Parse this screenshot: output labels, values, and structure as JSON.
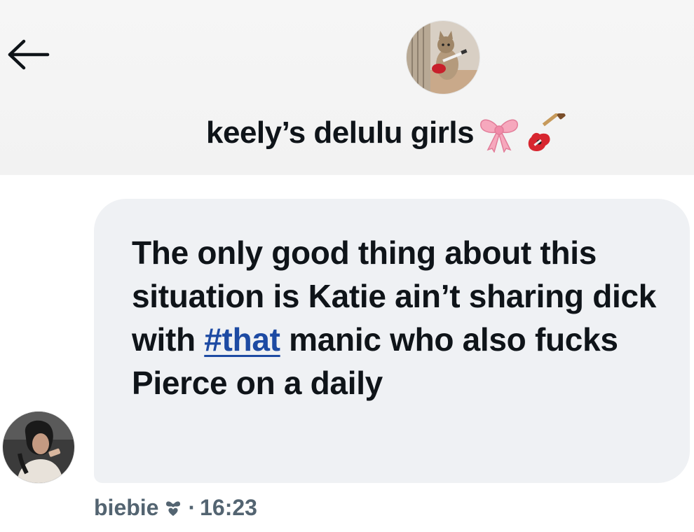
{
  "header": {
    "back_icon": "arrow-left-icon",
    "group_avatar_icon": "cat-with-guitar-avatar",
    "group_name": "keely’s delulu girls",
    "title_emojis": [
      "ribbon-emoji",
      "guitar-emoji"
    ]
  },
  "message": {
    "text_before_hashtag": "The only good thing about this situation is Katie ain’t sharing dick with",
    "hashtag": "#that",
    "text_after_hashtag": "manic who also fucks Pierce on a daily",
    "bubble_color": "#eff1f4",
    "hashtag_color": "#1d4aa3"
  },
  "sender": {
    "avatar_icon": "user-photo-avatar",
    "name": "biebie",
    "name_icon": "bow-heart-icon",
    "separator": "·",
    "time": "16:23"
  },
  "colors": {
    "text": "#0f1419",
    "meta_text": "#536471",
    "header_bg": "#f4f4f4"
  }
}
